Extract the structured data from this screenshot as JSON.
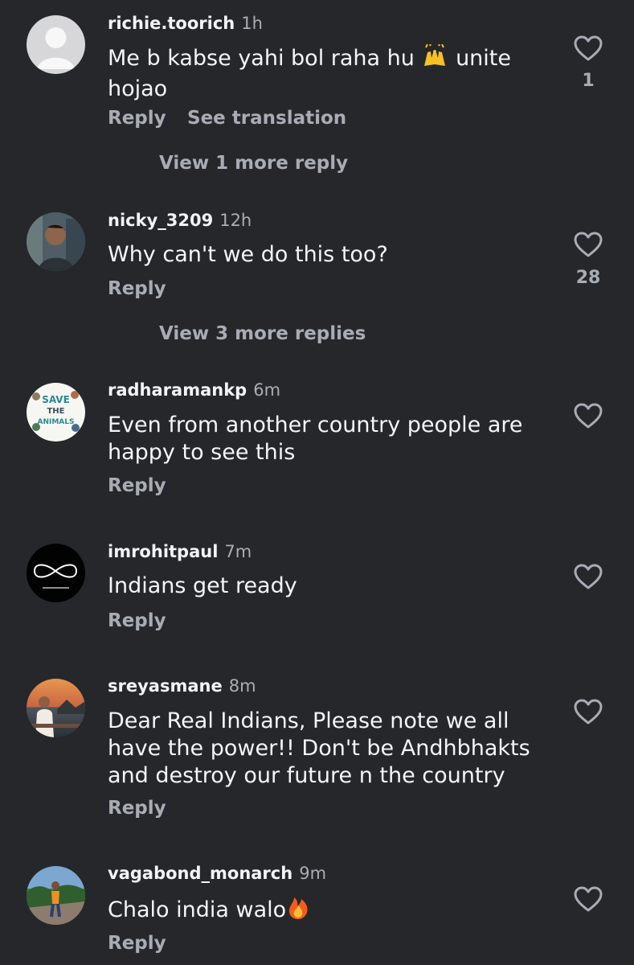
{
  "comments": [
    {
      "username": "richie.toorich",
      "time": "1h",
      "text_before_emoji": "Me b kabse yahi bol raha hu ",
      "emoji_1": "raising-hands-emoji",
      "text_after_emoji": " unite\nhojao",
      "reply_label": "Reply",
      "translation_label": "See translation",
      "likes": "1",
      "view_more_label": "View 1 more reply"
    },
    {
      "username": "nicky_3209",
      "time": "12h",
      "text": "Why can't we do this too?",
      "reply_label": "Reply",
      "likes": "28",
      "view_more_label": "View 3 more replies"
    },
    {
      "username": "radharamankp",
      "time": "6m",
      "text": "Even from another country people are\nhappy to see this",
      "reply_label": "Reply",
      "avatar_text": [
        "SAVE",
        "THE",
        "ANIMALS"
      ]
    },
    {
      "username": "imrohitpaul",
      "time": "7m",
      "text": "Indians get ready",
      "reply_label": "Reply"
    },
    {
      "username": "sreyasmane",
      "time": "8m",
      "text": "Dear Real Indians,  Please note we all\nhave the power!! Don't be Andhbhakts\nand destroy our future n the country",
      "reply_label": "Reply"
    },
    {
      "username": "vagabond_monarch",
      "time": "9m",
      "text_before_emoji": "Chalo india walo",
      "emoji_1": "fire-emoji",
      "reply_label": "Reply"
    }
  ],
  "colors": {
    "background": "#25272b",
    "text": "#f4f5f7",
    "secondary": "#a8acb4"
  }
}
